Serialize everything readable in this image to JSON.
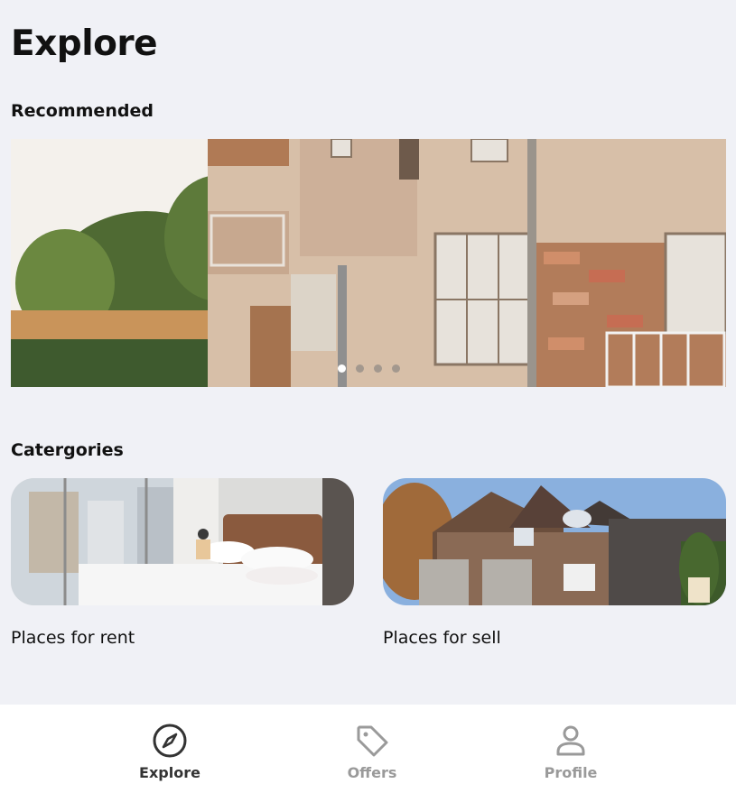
{
  "page": {
    "title": "Explore"
  },
  "recommended": {
    "heading": "Recommended",
    "carousel": {
      "slide_count": 4,
      "active_index": 0
    }
  },
  "categories": {
    "heading": "Catergories",
    "items": [
      {
        "label": "Places for rent",
        "image": "bedroom-photo"
      },
      {
        "label": "Places for sell",
        "image": "house-photo"
      }
    ]
  },
  "bottom_nav": {
    "items": [
      {
        "label": "Explore",
        "icon": "compass-icon",
        "active": true
      },
      {
        "label": "Offers",
        "icon": "tag-icon",
        "active": false
      },
      {
        "label": "Profile",
        "icon": "user-icon",
        "active": false
      }
    ]
  },
  "colors": {
    "background": "#f0f1f6",
    "nav_background": "#ffffff",
    "active_text": "#333333",
    "inactive_text": "#9a9a9a"
  }
}
